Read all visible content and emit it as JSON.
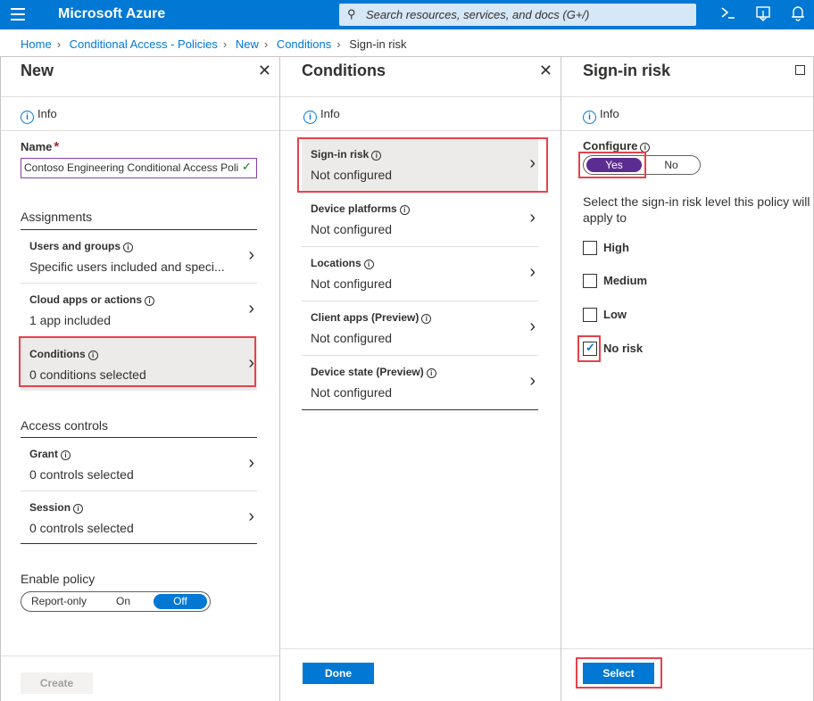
{
  "topbar": {
    "brand": "Microsoft Azure",
    "search_placeholder": "Search resources, services, and docs (G+/)",
    "icons": [
      "menu-icon",
      "search-icon",
      "cloud-shell-icon",
      "directory-filter-icon",
      "notifications-icon"
    ]
  },
  "breadcrumb": {
    "items": [
      "Home",
      "Conditional Access - Policies",
      "New",
      "Conditions"
    ],
    "current": "Sign-in risk"
  },
  "blade_new": {
    "title": "New",
    "info": "Info",
    "name_label": "Name",
    "name_value": "Contoso Engineering Conditional Access Poli",
    "assignments_heading": "Assignments",
    "assignments": [
      {
        "label": "Users and groups",
        "value": "Specific users included and speci..."
      },
      {
        "label": "Cloud apps or actions",
        "value": "1 app included"
      },
      {
        "label": "Conditions",
        "value": "0 conditions selected"
      }
    ],
    "access_heading": "Access controls",
    "access": [
      {
        "label": "Grant",
        "value": "0 controls selected"
      },
      {
        "label": "Session",
        "value": "0 controls selected"
      }
    ],
    "enable_policy_label": "Enable policy",
    "enable_policy_options": [
      "Report-only",
      "On",
      "Off"
    ],
    "enable_policy_selected": "Off",
    "create_button": "Create"
  },
  "blade_conditions": {
    "title": "Conditions",
    "info": "Info",
    "items": [
      {
        "label": "Sign-in risk",
        "value": "Not configured"
      },
      {
        "label": "Device platforms",
        "value": "Not configured"
      },
      {
        "label": "Locations",
        "value": "Not configured"
      },
      {
        "label": "Client apps (Preview)",
        "value": "Not configured"
      },
      {
        "label": "Device state (Preview)",
        "value": "Not configured"
      }
    ],
    "done_button": "Done"
  },
  "blade_signin": {
    "title": "Sign-in risk",
    "info": "Info",
    "configure_label": "Configure",
    "configure_options": [
      "Yes",
      "No"
    ],
    "configure_selected": "Yes",
    "description": "Select the sign-in risk level this policy will apply to",
    "levels": [
      {
        "label": "High",
        "checked": false
      },
      {
        "label": "Medium",
        "checked": false
      },
      {
        "label": "Low",
        "checked": false
      },
      {
        "label": "No risk",
        "checked": true
      }
    ],
    "select_button": "Select"
  },
  "colors": {
    "azure_blue": "#0078d4",
    "toggle_yes": "#5c2d91",
    "highlight_red": "#e6424b",
    "required_star": "#a4262c"
  }
}
